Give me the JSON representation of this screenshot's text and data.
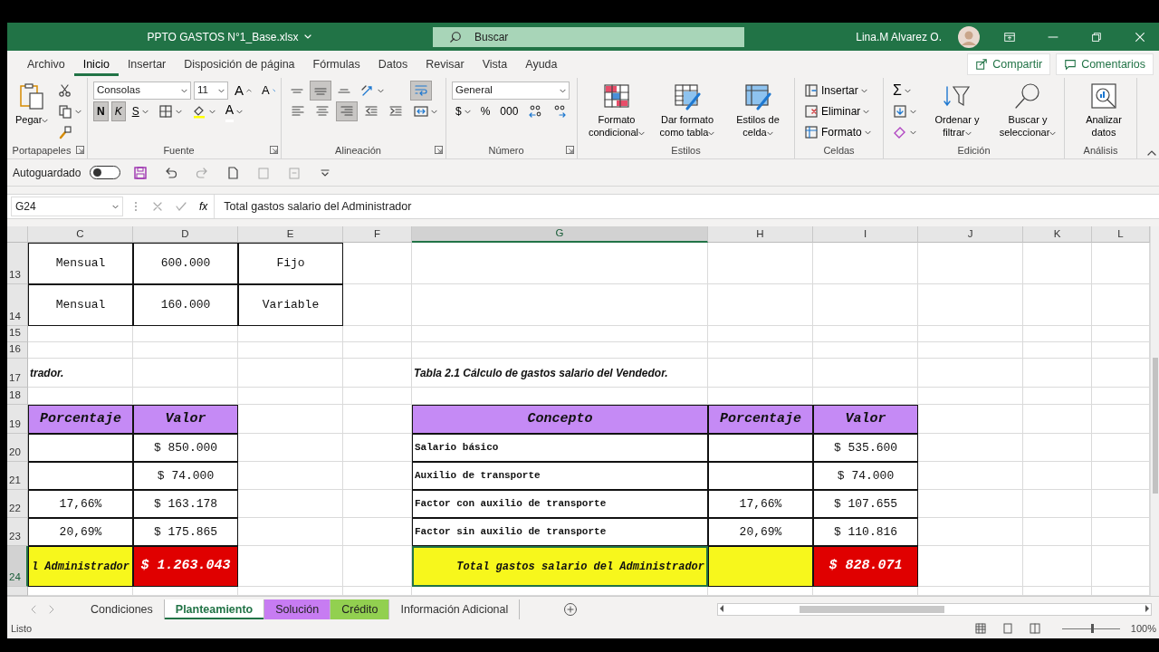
{
  "window": {
    "title": "PPTO GASTOS N°1_Base.xlsx",
    "search_placeholder": "Buscar",
    "user": "Lina.M Alvarez O."
  },
  "menu_tabs": [
    {
      "label": "Archivo",
      "selected": false
    },
    {
      "label": "Inicio",
      "selected": true
    },
    {
      "label": "Insertar",
      "selected": false
    },
    {
      "label": "Disposición de página",
      "selected": false
    },
    {
      "label": "Fórmulas",
      "selected": false
    },
    {
      "label": "Datos",
      "selected": false
    },
    {
      "label": "Revisar",
      "selected": false
    },
    {
      "label": "Vista",
      "selected": false
    },
    {
      "label": "Ayuda",
      "selected": false
    }
  ],
  "share_buttons": [
    {
      "kind": "share",
      "label": "Compartir"
    },
    {
      "kind": "comments",
      "label": "Comentarios"
    }
  ],
  "ribbon_groups": [
    {
      "label": "Portapapeles",
      "launcher": true,
      "blocks": [
        {
          "kind": "large",
          "items": [
            {
              "kind": "paste",
              "label": "Pegar",
              "dropdown": true
            }
          ]
        },
        {
          "kind": "stack",
          "lines": [
            {
              "items": [
                {
                  "kind": "cut"
                }
              ]
            },
            {
              "items": [
                {
                  "kind": "copy",
                  "dropdown": true
                }
              ]
            },
            {
              "items": [
                {
                  "kind": "painter"
                }
              ]
            }
          ]
        }
      ]
    },
    {
      "label": "Fuente",
      "launcher": true,
      "blocks": [
        {
          "kind": "stack",
          "lines": [
            {
              "items": [
                {
                  "kind": "font_field",
                  "value": "Consolas"
                },
                {
                  "kind": "size_field",
                  "value": "11"
                },
                {
                  "kind": "font_grow",
                  "label": "A"
                },
                {
                  "kind": "font_shrink",
                  "label": "A"
                }
              ]
            },
            {
              "items": [
                {
                  "kind": "bold",
                  "label": "N",
                  "selected": true
                },
                {
                  "kind": "italic",
                  "label": "K",
                  "selected": true
                },
                {
                  "kind": "underline",
                  "label": "S",
                  "selected": false,
                  "dropdown": true
                },
                {
                  "kind": "borders",
                  "dropdown": true
                },
                {
                  "kind": "fill_color",
                  "dropdown": true
                },
                {
                  "kind": "font_color",
                  "label": "A",
                  "dropdown": true
                }
              ]
            }
          ]
        }
      ]
    },
    {
      "label": "Alineación",
      "launcher": true,
      "blocks": [
        {
          "kind": "stack",
          "lines": [
            {
              "items": [
                {
                  "kind": "align_top",
                  "selected": false
                },
                {
                  "kind": "align_middle",
                  "selected": true
                },
                {
                  "kind": "align_bottom",
                  "selected": false
                },
                {
                  "kind": "orientation",
                  "selected": false,
                  "dropdown": true
                }
              ]
            },
            {
              "items": [
                {
                  "kind": "align_left",
                  "selected": false
                },
                {
                  "kind": "align_center",
                  "selected": false
                },
                {
                  "kind": "align_right",
                  "selected": true
                },
                {
                  "kind": "indent_less",
                  "selected": false
                },
                {
                  "kind": "indent_more",
                  "selected": false
                }
              ]
            }
          ]
        },
        {
          "kind": "stack",
          "lines": [
            {
              "items": [
                {
                  "kind": "wrap",
                  "selected": true
                }
              ]
            },
            {
              "items": [
                {
                  "kind": "merge",
                  "selected": false,
                  "dropdown": true
                }
              ]
            }
          ]
        }
      ]
    },
    {
      "label": "Número",
      "launcher": true,
      "blocks": [
        {
          "kind": "stack",
          "lines": [
            {
              "items": [
                {
                  "kind": "format_field",
                  "value": "General"
                }
              ]
            },
            {
              "items": [
                {
                  "kind": "currency",
                  "label": "$",
                  "dropdown": true
                },
                {
                  "kind": "percent",
                  "label": "%"
                },
                {
                  "kind": "thousands",
                  "label": "000"
                },
                {
                  "kind": "decimals_more"
                },
                {
                  "kind": "decimals_less"
                }
              ]
            }
          ]
        }
      ]
    },
    {
      "label": "Estilos",
      "blocks": [
        {
          "kind": "large",
          "items": [
            {
              "kind": "cond_format",
              "label": "Formato condicional",
              "dropdown": true
            },
            {
              "kind": "table_format",
              "label": "Dar formato como tabla",
              "dropdown": true
            },
            {
              "kind": "cell_styles",
              "label": "Estilos de celda",
              "dropdown": true
            }
          ]
        }
      ]
    },
    {
      "label": "Celdas",
      "blocks": [
        {
          "kind": "stack",
          "lines": [
            {
              "items": [
                {
                  "kind": "insert_cells",
                  "label": "Insertar",
                  "dropdown": true
                }
              ]
            },
            {
              "items": [
                {
                  "kind": "delete_cells",
                  "label": "Eliminar",
                  "dropdown": true
                }
              ]
            },
            {
              "items": [
                {
                  "kind": "format_cells",
                  "label": "Formato",
                  "dropdown": true
                }
              ]
            }
          ]
        }
      ]
    },
    {
      "label": "Edición",
      "blocks": [
        {
          "kind": "stack",
          "lines": [
            {
              "items": [
                {
                  "kind": "autosum",
                  "label": "Σ",
                  "dropdown": true
                }
              ]
            },
            {
              "items": [
                {
                  "kind": "fill_down",
                  "dropdown": true
                }
              ]
            },
            {
              "items": [
                {
                  "kind": "clear",
                  "dropdown": true
                }
              ]
            }
          ]
        },
        {
          "kind": "large",
          "items": [
            {
              "kind": "sort_filter",
              "label": "Ordenar y filtrar",
              "dropdown": true
            },
            {
              "kind": "find_select",
              "label": "Buscar y seleccionar",
              "dropdown": true
            }
          ]
        }
      ]
    },
    {
      "label": "Análisis",
      "blocks": [
        {
          "kind": "large",
          "items": [
            {
              "kind": "analyze",
              "label": "Analizar datos"
            }
          ]
        }
      ]
    }
  ],
  "quick_access": {
    "autosave_label": "Autoguardado",
    "autosave_on": false
  },
  "formula_bar": {
    "name_box": "G24",
    "function_label": "fx",
    "formula": "Total gastos salario del Administrador"
  },
  "columns": [
    {
      "label": "C",
      "selected": false
    },
    {
      "label": "D",
      "selected": false
    },
    {
      "label": "E",
      "selected": false
    },
    {
      "label": "F",
      "selected": false
    },
    {
      "label": "G",
      "selected": true
    },
    {
      "label": "H",
      "selected": false
    },
    {
      "label": "I",
      "selected": false
    },
    {
      "label": "J",
      "selected": false
    },
    {
      "label": "K",
      "selected": false
    },
    {
      "label": "L",
      "selected": false
    }
  ],
  "rows": [
    {
      "number": "13",
      "selected": false,
      "cells": [
        {
          "kind": "boxed",
          "text": "Mensual"
        },
        {
          "kind": "boxed",
          "text": "600.000"
        },
        {
          "kind": "boxed",
          "text": "Fijo"
        },
        {
          "kind": "blank"
        },
        {
          "kind": "blank"
        },
        {
          "kind": "blank"
        },
        {
          "kind": "blank"
        },
        {
          "kind": "blank"
        },
        {
          "kind": "blank"
        },
        {
          "kind": "blank"
        }
      ]
    },
    {
      "number": "14",
      "selected": false,
      "cells": [
        {
          "kind": "boxed",
          "text": "Mensual"
        },
        {
          "kind": "boxed",
          "text": "160.000"
        },
        {
          "kind": "boxed",
          "text": "Variable"
        },
        {
          "kind": "blank"
        },
        {
          "kind": "blank"
        },
        {
          "kind": "blank"
        },
        {
          "kind": "blank"
        },
        {
          "kind": "blank"
        },
        {
          "kind": "blank"
        },
        {
          "kind": "blank"
        }
      ]
    },
    {
      "number": "15",
      "selected": false,
      "cells": [
        {
          "kind": "blank"
        },
        {
          "kind": "blank"
        },
        {
          "kind": "blank"
        },
        {
          "kind": "blank"
        },
        {
          "kind": "blank"
        },
        {
          "kind": "blank"
        },
        {
          "kind": "blank"
        },
        {
          "kind": "blank"
        },
        {
          "kind": "blank"
        },
        {
          "kind": "blank"
        }
      ]
    },
    {
      "number": "16",
      "selected": false,
      "cells": [
        {
          "kind": "blank"
        },
        {
          "kind": "blank"
        },
        {
          "kind": "blank"
        },
        {
          "kind": "blank"
        },
        {
          "kind": "blank"
        },
        {
          "kind": "blank"
        },
        {
          "kind": "blank"
        },
        {
          "kind": "blank"
        },
        {
          "kind": "blank"
        },
        {
          "kind": "blank"
        }
      ]
    },
    {
      "number": "17",
      "selected": false,
      "cells": [
        {
          "kind": "title",
          "text": "trador."
        },
        {
          "kind": "blank"
        },
        {
          "kind": "blank"
        },
        {
          "kind": "blank"
        },
        {
          "kind": "title",
          "text": "Tabla 2.1 Cálculo de gastos salario del Vendedor."
        },
        {
          "kind": "blank"
        },
        {
          "kind": "blank"
        },
        {
          "kind": "blank"
        },
        {
          "kind": "blank"
        },
        {
          "kind": "blank"
        }
      ]
    },
    {
      "number": "18",
      "selected": false,
      "cells": [
        {
          "kind": "blank"
        },
        {
          "kind": "blank"
        },
        {
          "kind": "blank"
        },
        {
          "kind": "blank"
        },
        {
          "kind": "blank"
        },
        {
          "kind": "blank"
        },
        {
          "kind": "blank"
        },
        {
          "kind": "blank"
        },
        {
          "kind": "blank"
        },
        {
          "kind": "blank"
        }
      ]
    },
    {
      "number": "19",
      "selected": false,
      "cells": [
        {
          "kind": "header",
          "text": "Porcentaje"
        },
        {
          "kind": "header",
          "text": "Valor"
        },
        {
          "kind": "blank"
        },
        {
          "kind": "blank"
        },
        {
          "kind": "header",
          "text": "Concepto"
        },
        {
          "kind": "header",
          "text": "Porcentaje"
        },
        {
          "kind": "header",
          "text": "Valor"
        },
        {
          "kind": "blank"
        },
        {
          "kind": "blank"
        },
        {
          "kind": "blank"
        }
      ]
    },
    {
      "number": "20",
      "selected": false,
      "cells": [
        {
          "kind": "boxed"
        },
        {
          "kind": "boxed",
          "text": "$ 850.000"
        },
        {
          "kind": "blank"
        },
        {
          "kind": "blank"
        },
        {
          "kind": "label",
          "text": "Salario básico"
        },
        {
          "kind": "boxed"
        },
        {
          "kind": "boxed",
          "text": "$ 535.600"
        },
        {
          "kind": "blank"
        },
        {
          "kind": "blank"
        },
        {
          "kind": "blank"
        }
      ]
    },
    {
      "number": "21",
      "selected": false,
      "cells": [
        {
          "kind": "boxed"
        },
        {
          "kind": "boxed",
          "text": "$ 74.000"
        },
        {
          "kind": "blank"
        },
        {
          "kind": "blank"
        },
        {
          "kind": "label",
          "text": "Auxilio de transporte"
        },
        {
          "kind": "boxed"
        },
        {
          "kind": "boxed",
          "text": "$ 74.000"
        },
        {
          "kind": "blank"
        },
        {
          "kind": "blank"
        },
        {
          "kind": "blank"
        }
      ]
    },
    {
      "number": "22",
      "selected": false,
      "cells": [
        {
          "kind": "boxed",
          "text": "17,66%"
        },
        {
          "kind": "boxed",
          "text": "$ 163.178"
        },
        {
          "kind": "blank"
        },
        {
          "kind": "blank"
        },
        {
          "kind": "label",
          "text": "Factor con auxilio de transporte"
        },
        {
          "kind": "boxed",
          "text": "17,66%"
        },
        {
          "kind": "boxed",
          "text": "$ 107.655"
        },
        {
          "kind": "blank"
        },
        {
          "kind": "blank"
        },
        {
          "kind": "blank"
        }
      ]
    },
    {
      "number": "23",
      "selected": false,
      "cells": [
        {
          "kind": "boxed",
          "text": "20,69%"
        },
        {
          "kind": "boxed",
          "text": "$ 175.865"
        },
        {
          "kind": "blank"
        },
        {
          "kind": "blank"
        },
        {
          "kind": "label",
          "text": "Factor sin auxilio de transporte"
        },
        {
          "kind": "boxed",
          "text": "20,69%"
        },
        {
          "kind": "boxed",
          "text": "$ 110.816"
        },
        {
          "kind": "blank"
        },
        {
          "kind": "blank"
        },
        {
          "kind": "blank"
        }
      ]
    },
    {
      "number": "24",
      "selected": true,
      "cells": [
        {
          "kind": "total_label",
          "text": "l Administrador"
        },
        {
          "kind": "total_value",
          "text": "$ 1.263.043"
        },
        {
          "kind": "blank"
        },
        {
          "kind": "blank"
        },
        {
          "kind": "total_label",
          "text": "Total gastos salario del Administrador"
        },
        {
          "kind": "total_fill"
        },
        {
          "kind": "total_value",
          "text": "$ 828.071"
        },
        {
          "kind": "blank"
        },
        {
          "kind": "blank"
        },
        {
          "kind": "blank"
        }
      ]
    }
  ],
  "sheet_tabs": [
    {
      "label": "Condiciones",
      "selected": false
    },
    {
      "label": "Planteamiento",
      "selected": true
    },
    {
      "label": "Solución",
      "selected": false,
      "color": "#c77cf2"
    },
    {
      "label": "Crédito",
      "selected": false,
      "color": "#92d050"
    },
    {
      "label": "Información Adicional",
      "selected": false
    }
  ],
  "status_bar": {
    "text": "Listo",
    "zoom": "100%",
    "zoom_slider": {
      "level": 0.5
    }
  }
}
